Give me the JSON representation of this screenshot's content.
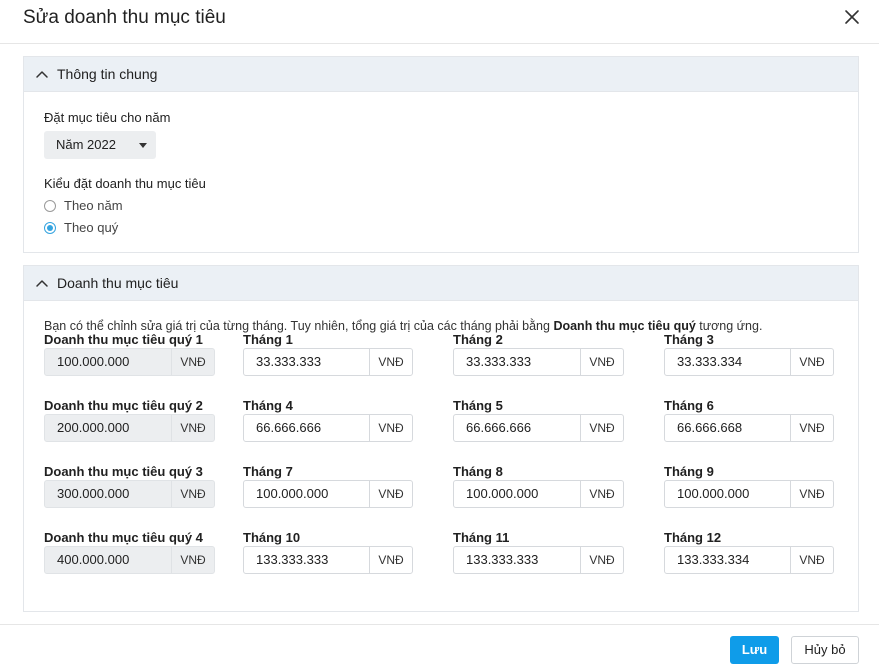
{
  "title": "Sửa doanh thu mục tiêu",
  "general": {
    "heading": "Thông tin chung",
    "year_label": "Đặt mục tiêu cho năm",
    "year_value": "Năm 2022",
    "mode_label": "Kiểu đặt doanh thu mục tiêu",
    "options": [
      {
        "label": "Theo năm",
        "checked": false
      },
      {
        "label": "Theo quý",
        "checked": true
      }
    ]
  },
  "target": {
    "heading": "Doanh thu mục tiêu",
    "note_prefix": "Bạn có thể chỉnh sửa giá trị của từng tháng. Tuy nhiên, tổng giá trị của các tháng phải bằng ",
    "note_bold": "Doanh thu mục tiêu quý",
    "note_suffix": " tương ứng.",
    "unit": "VNĐ",
    "quarters": [
      {
        "label": "Doanh thu mục tiêu quý 1",
        "value": "100.000.000",
        "months": [
          {
            "label": "Tháng 1",
            "value": "33.333.333"
          },
          {
            "label": "Tháng 2",
            "value": "33.333.333"
          },
          {
            "label": "Tháng 3",
            "value": "33.333.334"
          }
        ]
      },
      {
        "label": "Doanh thu mục tiêu quý 2",
        "value": "200.000.000",
        "months": [
          {
            "label": "Tháng 4",
            "value": "66.666.666"
          },
          {
            "label": "Tháng 5",
            "value": "66.666.666"
          },
          {
            "label": "Tháng 6",
            "value": "66.666.668"
          }
        ]
      },
      {
        "label": "Doanh thu mục tiêu quý 3",
        "value": "300.000.000",
        "months": [
          {
            "label": "Tháng 7",
            "value": "100.000.000"
          },
          {
            "label": "Tháng 8",
            "value": "100.000.000"
          },
          {
            "label": "Tháng 9",
            "value": "100.000.000"
          }
        ]
      },
      {
        "label": "Doanh thu mục tiêu quý 4",
        "value": "400.000.000",
        "months": [
          {
            "label": "Tháng 10",
            "value": "133.333.333"
          },
          {
            "label": "Tháng 11",
            "value": "133.333.333"
          },
          {
            "label": "Tháng 12",
            "value": "133.333.334"
          }
        ]
      }
    ]
  },
  "footer": {
    "save": "Lưu",
    "cancel": "Hủy bỏ"
  },
  "colors": {
    "primary": "#0f9ce9",
    "section_header": "#ebf0f5",
    "readonly_bg": "#eceef0",
    "radio_checked": "#35a4e0"
  },
  "icons": {
    "close": "close-icon",
    "collapse": "chevron-up-icon",
    "dropdown": "caret-down-icon"
  }
}
